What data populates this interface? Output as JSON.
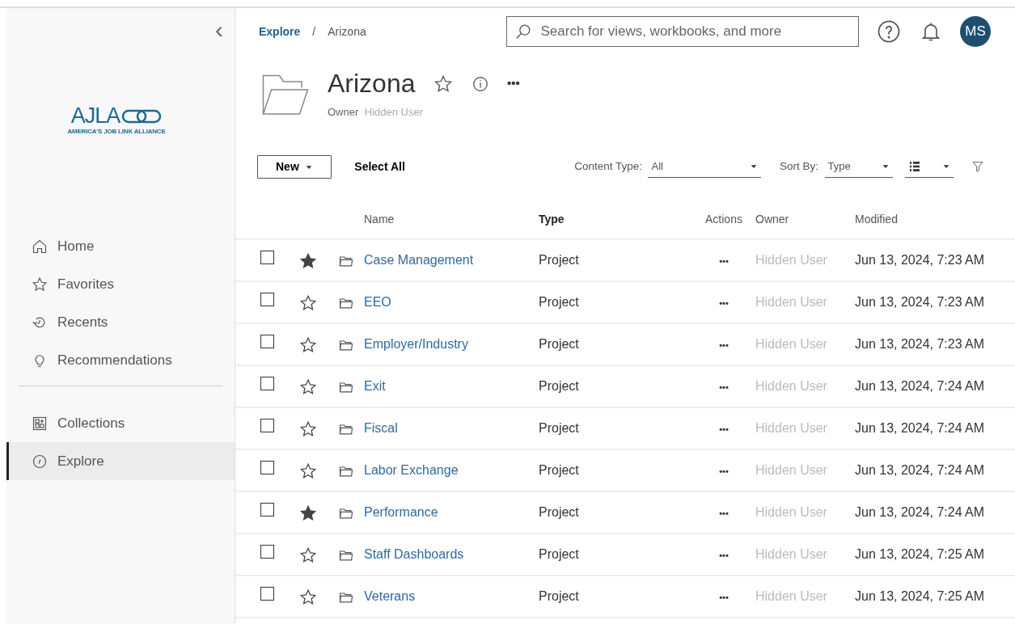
{
  "sidebar": {
    "collapse_icon": "‹",
    "logo": {
      "wordmark": "AJLA",
      "tagline": "AMERICA'S JOB LINK ALLIANCE"
    },
    "groups": [
      {
        "items": [
          {
            "kind": "home",
            "label": "Home",
            "selected": false
          },
          {
            "kind": "star",
            "label": "Favorites",
            "selected": false
          },
          {
            "kind": "recents",
            "label": "Recents",
            "selected": false
          },
          {
            "kind": "bulb",
            "label": "Recommendations",
            "selected": false
          }
        ]
      },
      {
        "items": [
          {
            "kind": "collections",
            "label": "Collections",
            "selected": false
          },
          {
            "kind": "explore",
            "label": "Explore",
            "selected": true
          }
        ]
      }
    ]
  },
  "header": {
    "breadcrumb": [
      {
        "label": "Explore",
        "link": true
      },
      {
        "label": "Arizona",
        "link": false
      }
    ],
    "separator": "/",
    "search": {
      "placeholder": "Search for views, workbooks, and more"
    },
    "avatar": "MS"
  },
  "project": {
    "title": "Arizona",
    "favorite": false,
    "more": "•••",
    "owner_label": "Owner",
    "owner": "Hidden User"
  },
  "toolbar": {
    "new_button": "New",
    "select_all": "Select All",
    "content_type_label": "Content Type:",
    "content_type": "All",
    "sort_label": "Sort By:",
    "sort": "Type"
  },
  "table": {
    "columns": [
      {
        "label": "Name",
        "sorted": false
      },
      {
        "label": "Type",
        "sorted": true
      },
      {
        "label": "Actions",
        "sorted": false
      },
      {
        "label": "Owner",
        "sorted": false
      },
      {
        "label": "Modified",
        "sorted": false
      }
    ],
    "rows": [
      {
        "checked": false,
        "favorite": true,
        "name": "Case Management",
        "type": "Project",
        "actions": "•••",
        "owner": "Hidden User",
        "modified": "Jun 13, 2024, 7:23 AM"
      },
      {
        "checked": false,
        "favorite": false,
        "name": "EEO",
        "type": "Project",
        "actions": "•••",
        "owner": "Hidden User",
        "modified": "Jun 13, 2024, 7:23 AM"
      },
      {
        "checked": false,
        "favorite": false,
        "name": "Employer/Industry",
        "type": "Project",
        "actions": "•••",
        "owner": "Hidden User",
        "modified": "Jun 13, 2024, 7:23 AM"
      },
      {
        "checked": false,
        "favorite": false,
        "name": "Exit",
        "type": "Project",
        "actions": "•••",
        "owner": "Hidden User",
        "modified": "Jun 13, 2024, 7:24 AM"
      },
      {
        "checked": false,
        "favorite": false,
        "name": "Fiscal",
        "type": "Project",
        "actions": "•••",
        "owner": "Hidden User",
        "modified": "Jun 13, 2024, 7:24 AM"
      },
      {
        "checked": false,
        "favorite": false,
        "name": "Labor Exchange",
        "type": "Project",
        "actions": "•••",
        "owner": "Hidden User",
        "modified": "Jun 13, 2024, 7:24 AM"
      },
      {
        "checked": false,
        "favorite": true,
        "name": "Performance",
        "type": "Project",
        "actions": "•••",
        "owner": "Hidden User",
        "modified": "Jun 13, 2024, 7:24 AM"
      },
      {
        "checked": false,
        "favorite": false,
        "name": "Staff Dashboards",
        "type": "Project",
        "actions": "•••",
        "owner": "Hidden User",
        "modified": "Jun 13, 2024, 7:25 AM"
      },
      {
        "checked": false,
        "favorite": false,
        "name": "Veterans",
        "type": "Project",
        "actions": "•••",
        "owner": "Hidden User",
        "modified": "Jun 13, 2024, 7:25 AM"
      }
    ]
  }
}
